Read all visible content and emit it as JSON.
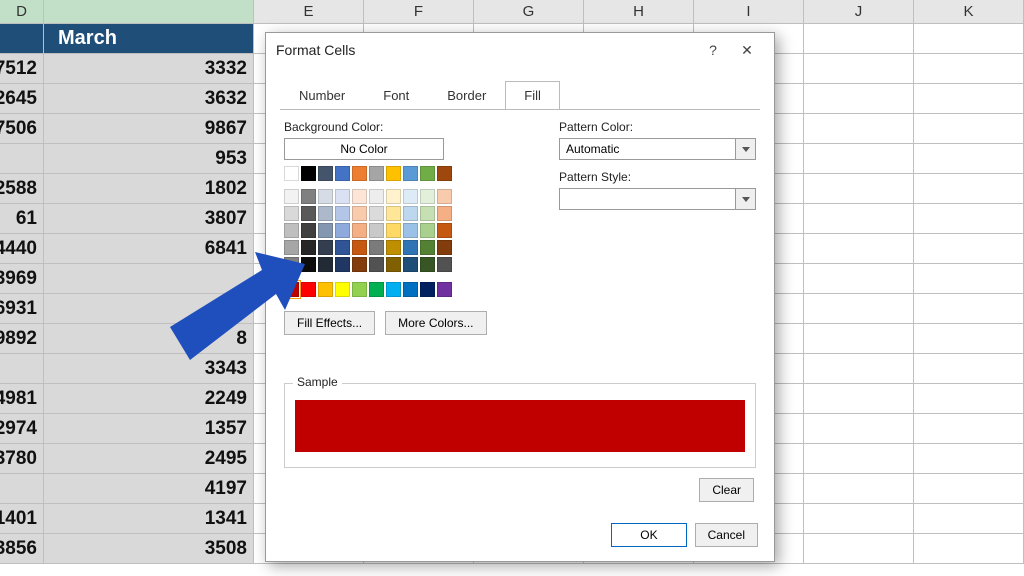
{
  "columns": [
    "D",
    "E",
    "F",
    "G",
    "H",
    "I",
    "J",
    "K"
  ],
  "header_label": "March",
  "table": {
    "colD": [
      "7512",
      "2645",
      "7506",
      "",
      "2588",
      "61",
      "4440",
      "3969",
      "6931",
      "9892",
      "",
      "4981",
      "2974",
      "3780",
      "",
      "1401",
      "3856"
    ],
    "colE": [
      "3332",
      "3632",
      "9867",
      "953",
      "1802",
      "3807",
      "6841",
      "",
      "282",
      "8",
      "3343",
      "2249",
      "1357",
      "2495",
      "4197",
      "1341",
      "3508"
    ]
  },
  "dialog": {
    "title": "Format Cells",
    "help": "?",
    "close": "✕",
    "tabs": [
      "Number",
      "Font",
      "Border",
      "Fill"
    ],
    "active_tab": "Fill",
    "bg_label": "Background Color:",
    "no_color": "No Color",
    "fill_effects": "Fill Effects...",
    "more_colors": "More Colors...",
    "pattern_color_label": "Pattern Color:",
    "pattern_color_value": "Automatic",
    "pattern_style_label": "Pattern Style:",
    "sample_label": "Sample",
    "clear": "Clear",
    "ok": "OK",
    "cancel": "Cancel",
    "sample_color": "#c00000"
  },
  "palette": {
    "theme_row1": [
      "#ffffff",
      "#000000",
      "#44546a",
      "#4472c4",
      "#ed7d31",
      "#a5a5a5",
      "#ffc000",
      "#5b9bd5",
      "#70ad47",
      "#9e480e"
    ],
    "tints": [
      [
        "#f2f2f2",
        "#808080",
        "#d6dce5",
        "#d9e1f2",
        "#fce4d6",
        "#ededed",
        "#fff2cc",
        "#ddebf7",
        "#e2efda",
        "#f8cbad"
      ],
      [
        "#d9d9d9",
        "#595959",
        "#acb9ca",
        "#b4c6e7",
        "#f8cbad",
        "#dbdbdb",
        "#ffe699",
        "#bdd7ee",
        "#c6e0b4",
        "#f4b084"
      ],
      [
        "#bfbfbf",
        "#404040",
        "#8497b0",
        "#8ea9db",
        "#f4b084",
        "#c9c9c9",
        "#ffd966",
        "#9bc2e6",
        "#a9d08e",
        "#c65911"
      ],
      [
        "#a6a6a6",
        "#262626",
        "#333f4f",
        "#305496",
        "#c65911",
        "#7b7b7b",
        "#bf8f00",
        "#2f75b5",
        "#548235",
        "#833c0c"
      ],
      [
        "#808080",
        "#0d0d0d",
        "#222b35",
        "#203764",
        "#833c0c",
        "#525252",
        "#806000",
        "#1f4e78",
        "#375623",
        "#525252"
      ]
    ],
    "standard": [
      "#c00000",
      "#ff0000",
      "#ffc000",
      "#ffff00",
      "#92d050",
      "#00b050",
      "#00b0f0",
      "#0070c0",
      "#002060",
      "#7030a0"
    ]
  }
}
